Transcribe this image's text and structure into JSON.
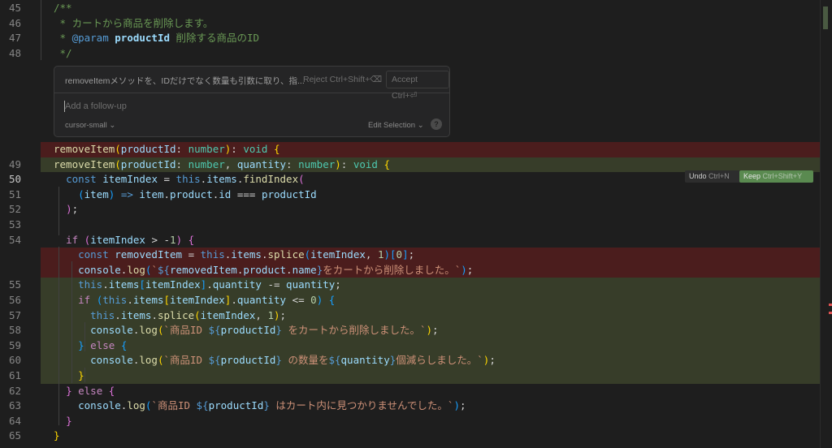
{
  "editor": {
    "lines": [
      {
        "num": "45",
        "tokens": [
          [
            "t-cmt",
            "/**"
          ]
        ]
      },
      {
        "num": "46",
        "tokens": [
          [
            "t-cmt",
            " * カートから商品を削除します。"
          ]
        ]
      },
      {
        "num": "47",
        "tokens": [
          [
            "t-cmt",
            " * "
          ],
          [
            "t-jd",
            "@param"
          ],
          [
            "t-cmt",
            " "
          ],
          [
            "t-jdp",
            "productId"
          ],
          [
            "t-cmt",
            " 削除する商品のID"
          ]
        ]
      },
      {
        "num": "48",
        "tokens": [
          [
            "t-cmt",
            " */"
          ]
        ]
      },
      {
        "num": "",
        "kind": "del",
        "tokens": [
          [
            "t-fn",
            "removeItem"
          ],
          [
            "t-p1",
            "("
          ],
          [
            "t-var",
            "productId"
          ],
          [
            "t-op",
            ": "
          ],
          [
            "t-type",
            "number"
          ],
          [
            "t-p1",
            ")"
          ],
          [
            "t-op",
            ": "
          ],
          [
            "t-type",
            "void"
          ],
          [
            "t-op",
            " "
          ],
          [
            "t-p1",
            "{"
          ]
        ]
      },
      {
        "num": "49",
        "kind": "add",
        "tokens": [
          [
            "t-fn",
            "removeItem"
          ],
          [
            "t-p1",
            "("
          ],
          [
            "t-var",
            "productId"
          ],
          [
            "t-op",
            ": "
          ],
          [
            "t-type",
            "number"
          ],
          [
            "t-op",
            ", "
          ],
          [
            "t-var",
            "quantity"
          ],
          [
            "t-op",
            ": "
          ],
          [
            "t-type",
            "number"
          ],
          [
            "t-p1",
            ")"
          ],
          [
            "t-op",
            ": "
          ],
          [
            "t-type",
            "void"
          ],
          [
            "t-op",
            " "
          ],
          [
            "t-p1",
            "{"
          ]
        ]
      },
      {
        "num": "50",
        "active": true,
        "tokens": [
          [
            "t-op",
            "  "
          ],
          [
            "t-kw",
            "const"
          ],
          [
            "t-op",
            " "
          ],
          [
            "t-var",
            "itemIndex"
          ],
          [
            "t-op",
            " = "
          ],
          [
            "t-kw",
            "this"
          ],
          [
            "t-op",
            "."
          ],
          [
            "t-var",
            "items"
          ],
          [
            "t-op",
            "."
          ],
          [
            "t-fn",
            "findIndex"
          ],
          [
            "t-p2",
            "("
          ]
        ]
      },
      {
        "num": "51",
        "tokens": [
          [
            "t-op",
            "    "
          ],
          [
            "t-p3",
            "("
          ],
          [
            "t-var",
            "item"
          ],
          [
            "t-p3",
            ")"
          ],
          [
            "t-op",
            " "
          ],
          [
            "t-kw",
            "=>"
          ],
          [
            "t-op",
            " "
          ],
          [
            "t-var",
            "item"
          ],
          [
            "t-op",
            "."
          ],
          [
            "t-var",
            "product"
          ],
          [
            "t-op",
            "."
          ],
          [
            "t-var",
            "id"
          ],
          [
            "t-op",
            " === "
          ],
          [
            "t-var",
            "productId"
          ]
        ]
      },
      {
        "num": "52",
        "tokens": [
          [
            "t-op",
            "  "
          ],
          [
            "t-p2",
            ")"
          ],
          [
            "t-op",
            ";"
          ]
        ]
      },
      {
        "num": "53",
        "tokens": []
      },
      {
        "num": "54",
        "tokens": [
          [
            "t-op",
            "  "
          ],
          [
            "t-kw2",
            "if"
          ],
          [
            "t-op",
            " "
          ],
          [
            "t-p2",
            "("
          ],
          [
            "t-var",
            "itemIndex"
          ],
          [
            "t-op",
            " > -"
          ],
          [
            "t-num",
            "1"
          ],
          [
            "t-p2",
            ")"
          ],
          [
            "t-op",
            " "
          ],
          [
            "t-p2",
            "{"
          ]
        ]
      },
      {
        "num": "",
        "kind": "del",
        "tokens": [
          [
            "t-op",
            "    "
          ],
          [
            "t-kw",
            "const"
          ],
          [
            "t-op",
            " "
          ],
          [
            "t-var",
            "removedItem"
          ],
          [
            "t-op",
            " = "
          ],
          [
            "t-kw",
            "this"
          ],
          [
            "t-op",
            "."
          ],
          [
            "t-var",
            "items"
          ],
          [
            "t-op",
            "."
          ],
          [
            "t-fn",
            "splice"
          ],
          [
            "t-p3",
            "("
          ],
          [
            "t-var",
            "itemIndex"
          ],
          [
            "t-op",
            ", "
          ],
          [
            "t-num",
            "1"
          ],
          [
            "t-p3",
            ")"
          ],
          [
            "t-p3",
            "["
          ],
          [
            "t-num",
            "0"
          ],
          [
            "t-p3",
            "]"
          ],
          [
            "t-op",
            ";"
          ]
        ]
      },
      {
        "num": "",
        "kind": "del",
        "tokens": [
          [
            "t-op",
            "    "
          ],
          [
            "t-var",
            "console"
          ],
          [
            "t-op",
            "."
          ],
          [
            "t-fn",
            "log"
          ],
          [
            "t-p3",
            "("
          ],
          [
            "t-str",
            "`"
          ],
          [
            "t-interp",
            "${"
          ],
          [
            "t-var",
            "removedItem"
          ],
          [
            "t-op",
            "."
          ],
          [
            "t-var",
            "product"
          ],
          [
            "t-op",
            "."
          ],
          [
            "t-var",
            "name"
          ],
          [
            "t-interp",
            "}"
          ],
          [
            "t-str",
            "をカートから削除しました。`"
          ],
          [
            "t-p3",
            ")"
          ],
          [
            "t-op",
            ";"
          ]
        ]
      },
      {
        "num": "55",
        "kind": "add",
        "tokens": [
          [
            "t-op",
            "    "
          ],
          [
            "t-kw",
            "this"
          ],
          [
            "t-op",
            "."
          ],
          [
            "t-var",
            "items"
          ],
          [
            "t-p3",
            "["
          ],
          [
            "t-var",
            "itemIndex"
          ],
          [
            "t-p3",
            "]"
          ],
          [
            "t-op",
            "."
          ],
          [
            "t-var",
            "quantity"
          ],
          [
            "t-op",
            " -= "
          ],
          [
            "t-var",
            "quantity"
          ],
          [
            "t-op",
            ";"
          ]
        ]
      },
      {
        "num": "56",
        "kind": "add",
        "tokens": [
          [
            "t-op",
            "    "
          ],
          [
            "t-kw2",
            "if"
          ],
          [
            "t-op",
            " "
          ],
          [
            "t-p3",
            "("
          ],
          [
            "t-kw",
            "this"
          ],
          [
            "t-op",
            "."
          ],
          [
            "t-var",
            "items"
          ],
          [
            "t-p1",
            "["
          ],
          [
            "t-var",
            "itemIndex"
          ],
          [
            "t-p1",
            "]"
          ],
          [
            "t-op",
            "."
          ],
          [
            "t-var",
            "quantity"
          ],
          [
            "t-op",
            " <= "
          ],
          [
            "t-num",
            "0"
          ],
          [
            "t-p3",
            ")"
          ],
          [
            "t-op",
            " "
          ],
          [
            "t-p3",
            "{"
          ]
        ]
      },
      {
        "num": "57",
        "kind": "add",
        "tokens": [
          [
            "t-op",
            "      "
          ],
          [
            "t-kw",
            "this"
          ],
          [
            "t-op",
            "."
          ],
          [
            "t-var",
            "items"
          ],
          [
            "t-op",
            "."
          ],
          [
            "t-fn",
            "splice"
          ],
          [
            "t-p1",
            "("
          ],
          [
            "t-var",
            "itemIndex"
          ],
          [
            "t-op",
            ", "
          ],
          [
            "t-num",
            "1"
          ],
          [
            "t-p1",
            ")"
          ],
          [
            "t-op",
            ";"
          ]
        ]
      },
      {
        "num": "58",
        "kind": "add",
        "tokens": [
          [
            "t-op",
            "      "
          ],
          [
            "t-var",
            "console"
          ],
          [
            "t-op",
            "."
          ],
          [
            "t-fn",
            "log"
          ],
          [
            "t-p1",
            "("
          ],
          [
            "t-str",
            "`商品ID "
          ],
          [
            "t-interp",
            "${"
          ],
          [
            "t-var",
            "productId"
          ],
          [
            "t-interp",
            "}"
          ],
          [
            "t-str",
            " をカートから削除しました。`"
          ],
          [
            "t-p1",
            ")"
          ],
          [
            "t-op",
            ";"
          ]
        ]
      },
      {
        "num": "59",
        "kind": "add",
        "tokens": [
          [
            "t-op",
            "    "
          ],
          [
            "t-p3",
            "}"
          ],
          [
            "t-op",
            " "
          ],
          [
            "t-kw2",
            "else"
          ],
          [
            "t-op",
            " "
          ],
          [
            "t-p3",
            "{"
          ]
        ]
      },
      {
        "num": "60",
        "kind": "add",
        "tokens": [
          [
            "t-op",
            "      "
          ],
          [
            "t-var",
            "console"
          ],
          [
            "t-op",
            "."
          ],
          [
            "t-fn",
            "log"
          ],
          [
            "t-p1",
            "("
          ],
          [
            "t-str",
            "`商品ID "
          ],
          [
            "t-interp",
            "${"
          ],
          [
            "t-var",
            "productId"
          ],
          [
            "t-interp",
            "}"
          ],
          [
            "t-str",
            " の数量を"
          ],
          [
            "t-interp",
            "${"
          ],
          [
            "t-var",
            "quantity"
          ],
          [
            "t-interp",
            "}"
          ],
          [
            "t-str",
            "個減らしました。`"
          ],
          [
            "t-p1",
            ")"
          ],
          [
            "t-op",
            ";"
          ]
        ]
      },
      {
        "num": "61",
        "kind": "add",
        "tokens": [
          [
            "t-op",
            "    "
          ],
          [
            "t-p1",
            "}"
          ]
        ]
      },
      {
        "num": "62",
        "tokens": [
          [
            "t-op",
            "  "
          ],
          [
            "t-p2",
            "}"
          ],
          [
            "t-op",
            " "
          ],
          [
            "t-kw2",
            "else"
          ],
          [
            "t-op",
            " "
          ],
          [
            "t-p2",
            "{"
          ]
        ]
      },
      {
        "num": "63",
        "tokens": [
          [
            "t-op",
            "    "
          ],
          [
            "t-var",
            "console"
          ],
          [
            "t-op",
            "."
          ],
          [
            "t-fn",
            "log"
          ],
          [
            "t-p3",
            "("
          ],
          [
            "t-str",
            "`商品ID "
          ],
          [
            "t-interp",
            "${"
          ],
          [
            "t-var",
            "productId"
          ],
          [
            "t-interp",
            "}"
          ],
          [
            "t-str",
            " はカート内に見つかりませんでした。`"
          ],
          [
            "t-p3",
            ")"
          ],
          [
            "t-op",
            ";"
          ]
        ]
      },
      {
        "num": "64",
        "tokens": [
          [
            "t-op",
            "  "
          ],
          [
            "t-p2",
            "}"
          ]
        ]
      },
      {
        "num": "65",
        "tokens": [
          [
            "t-p1",
            "}"
          ]
        ]
      }
    ]
  },
  "prompt": {
    "text": "removeItemメソッドを、IDだけでなく数量も引数に取り、指...",
    "reject_label": "Reject Ctrl+Shift+⌫",
    "accept_label": "Accept Ctrl+⏎",
    "followup_placeholder": "Add a follow-up",
    "model_label": "cursor-small ⌄",
    "edit_selection_label": "Edit Selection ⌄",
    "help_label": "?"
  },
  "diff_actions": {
    "undo_label": "Undo",
    "undo_key": "Ctrl+N",
    "keep_label": "Keep",
    "keep_key": "Ctrl+Shift+Y"
  },
  "colors": {
    "deleted_bg": "#4b1d1d",
    "added_bg": "#373d29",
    "keep_button": "#5a8a50"
  }
}
